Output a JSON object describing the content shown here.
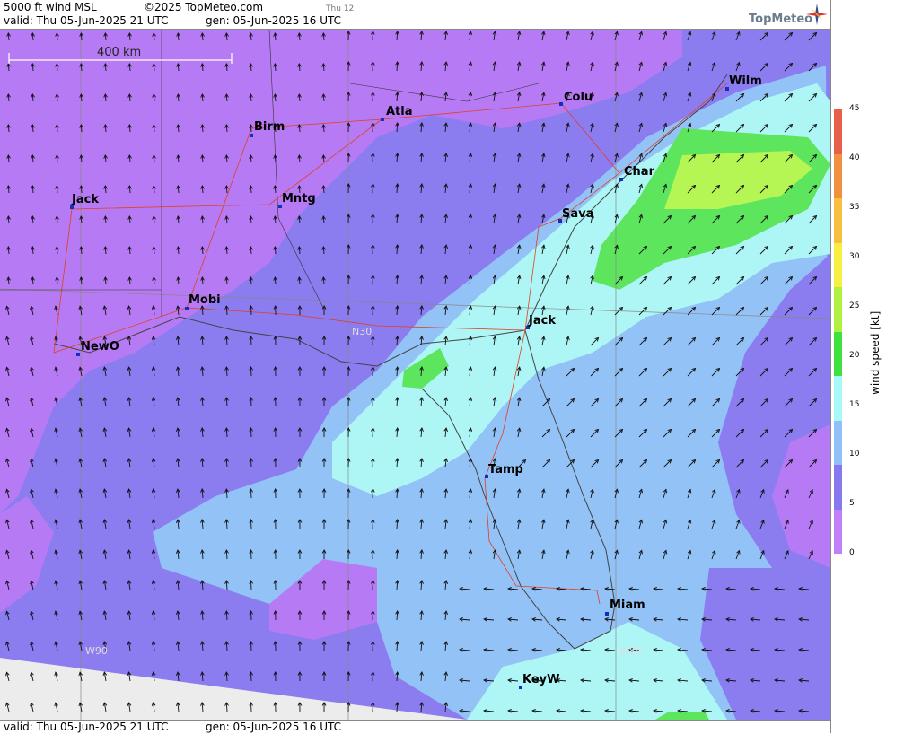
{
  "header": {
    "title": "5000 ft wind MSL",
    "copyright": "©2025 TopMeteo.com",
    "day_tag": "Thu 12",
    "valid": "valid:  Thu  05-Jun-2025  21 UTC",
    "gen": "gen: 05-Jun-2025 16 UTC",
    "logo": "TopMeteo"
  },
  "footer": {
    "valid": "valid:  Thu  05-Jun-2025  21 UTC",
    "gen": "gen: 05-Jun-2025 16 UTC"
  },
  "map": {
    "scale_label": "400 km",
    "grid_labels": {
      "n30": "N30",
      "w90": "W90",
      "w80": "W80"
    },
    "cities": [
      {
        "name": "Atla"
      },
      {
        "name": "Colu"
      },
      {
        "name": "Wilm"
      },
      {
        "name": "Birm"
      },
      {
        "name": "Char"
      },
      {
        "name": "Jack"
      },
      {
        "name": "Mntg"
      },
      {
        "name": "Sava"
      },
      {
        "name": "Mobi"
      },
      {
        "name": "Jack"
      },
      {
        "name": "NewO"
      },
      {
        "name": "Tamp"
      },
      {
        "name": "Miam"
      },
      {
        "name": "KeyW"
      }
    ]
  },
  "legend": {
    "unit_label": "wind speed [kt]",
    "ticks": [
      "45",
      "40",
      "35",
      "30",
      "25",
      "20",
      "15",
      "10",
      "5",
      "0"
    ],
    "colors": [
      "#e8604a",
      "#f09040",
      "#f8c040",
      "#f8f040",
      "#b0f040",
      "#40e040",
      "#a8f8f8",
      "#90c0f8",
      "#8878f0",
      "#c080f8"
    ]
  },
  "colors": {
    "purple": "#b77af5",
    "violet": "#8b7cf0",
    "light_blue": "#93c2f7",
    "cyan": "#aef6f6",
    "green": "#5ee55e",
    "lime": "#b5f554",
    "gray_nodata": "#ececec"
  }
}
